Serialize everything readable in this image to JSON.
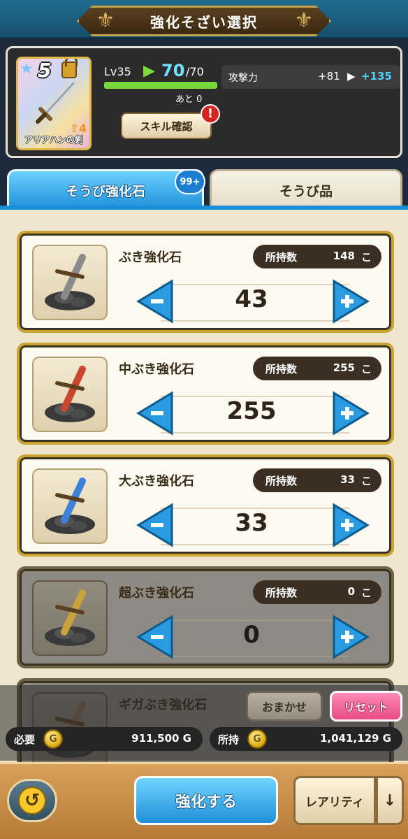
{
  "header": {
    "title": "強化そざい選択"
  },
  "item": {
    "rarity": "5",
    "name": "アリアハンの剣",
    "plus_count": "4",
    "level_label": "Lv35",
    "level_current": "70",
    "level_max": "/70",
    "exp_fraction": 1.0,
    "remaining": "あと 0",
    "skill_button": "スキル確認",
    "alert": "!",
    "stat_label": "攻撃力",
    "stat_base": "+81",
    "stat_new": "+135"
  },
  "tabs": {
    "active_label": "そうび強化石",
    "active_badge": "99+",
    "inactive_label": "そうび品"
  },
  "stones": [
    {
      "name": "ぶき強化石",
      "owned_label": "所持数",
      "owned": "148",
      "unit": "こ",
      "qty": "43",
      "disabled": false,
      "color": "#8a8a8a"
    },
    {
      "name": "中ぶき強化石",
      "owned_label": "所持数",
      "owned": "255",
      "unit": "こ",
      "qty": "255",
      "disabled": false,
      "color": "#c8472e"
    },
    {
      "name": "大ぶき強化石",
      "owned_label": "所持数",
      "owned": "33",
      "unit": "こ",
      "qty": "33",
      "disabled": false,
      "color": "#3c82d8"
    },
    {
      "name": "超ぶき強化石",
      "owned_label": "所持数",
      "owned": "0",
      "unit": "こ",
      "qty": "0",
      "disabled": true,
      "color": "#c9a23c"
    },
    {
      "name": "ギガぶき強化石",
      "disabled": true,
      "color": "#8a6f5a"
    }
  ],
  "footer": {
    "auto_label": "おまかせ",
    "reset_label": "リセット",
    "need_label": "必要",
    "need_value": "911,500 G",
    "have_label": "所持",
    "have_value": "1,041,129 G",
    "gold_symbol": "G",
    "enhance_label": "強化する",
    "rarity_label": "レアリティ",
    "sort_icon": "↓",
    "back_icon": "↺"
  }
}
